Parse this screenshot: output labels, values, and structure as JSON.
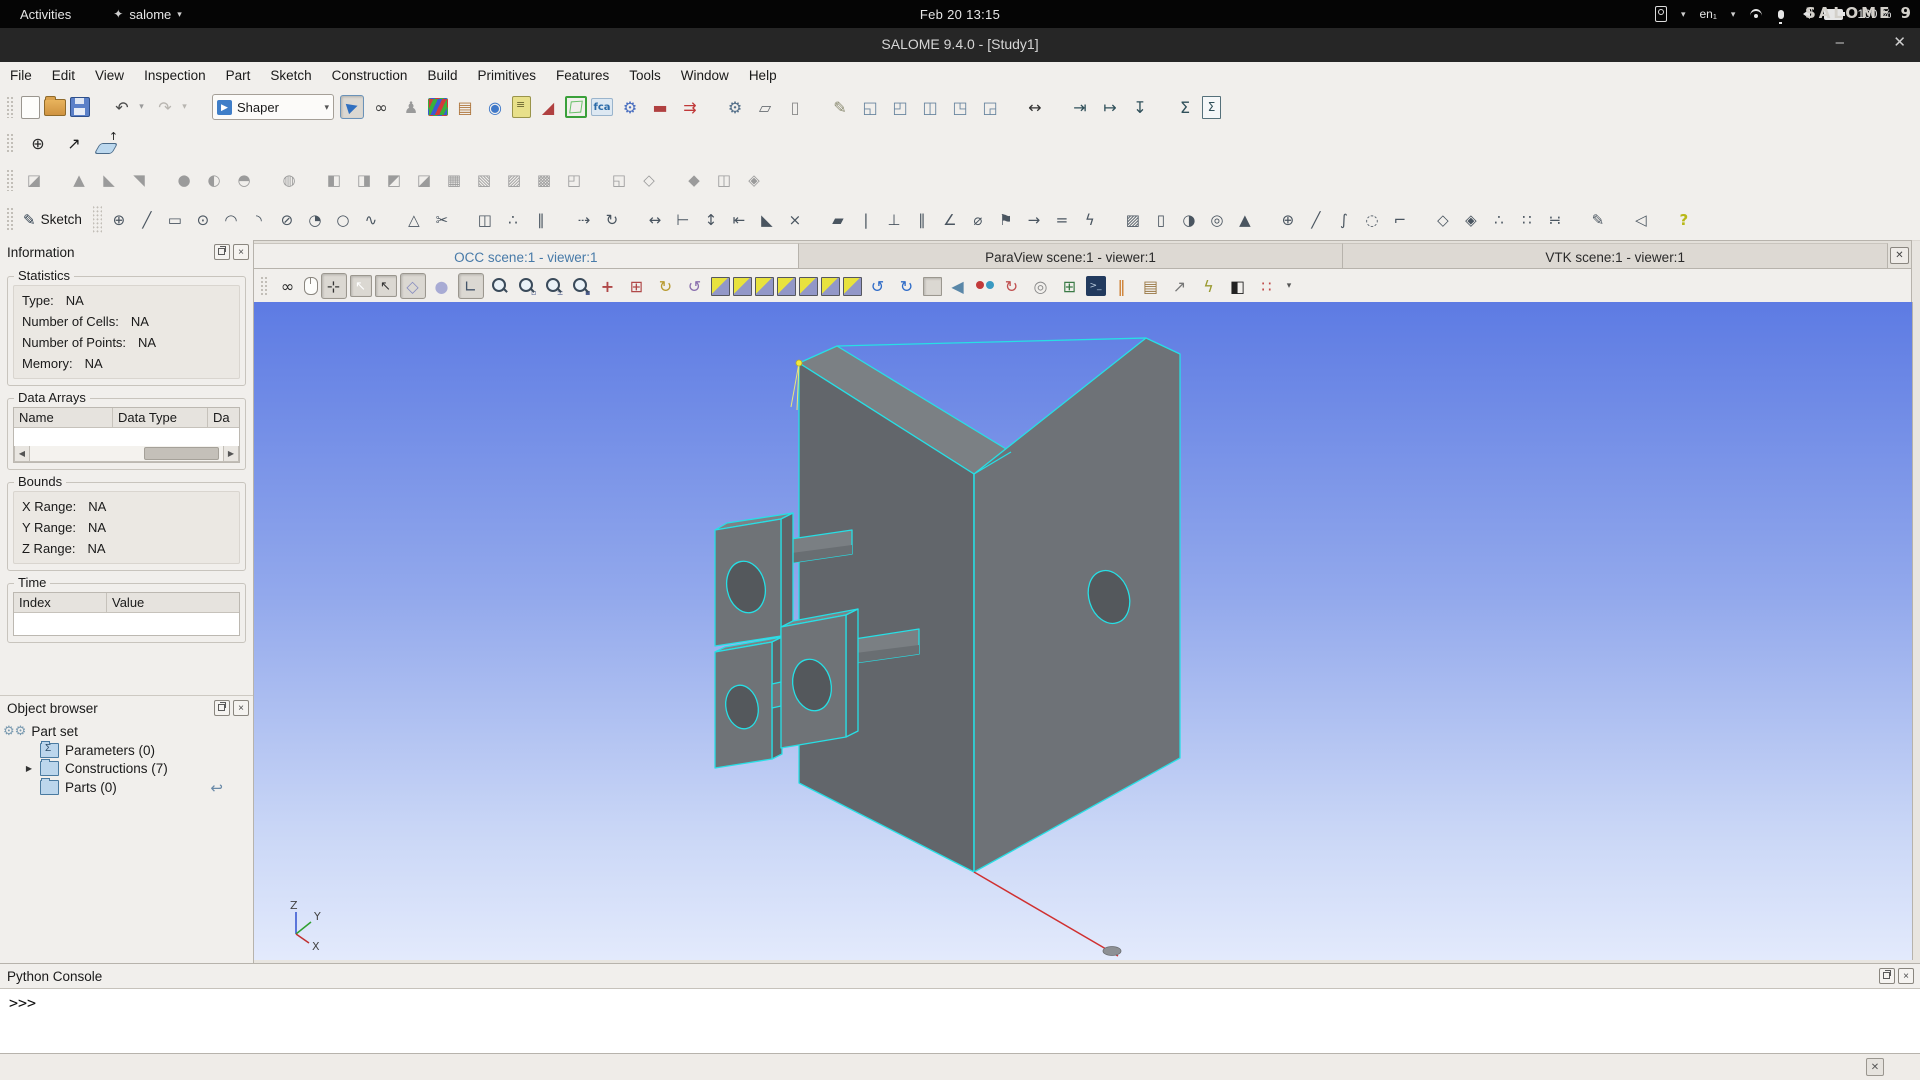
{
  "gnome_bar": {
    "activities": "Activities",
    "app_menu": "salome",
    "clock": "Feb 20 13:15",
    "keyboard_layout": "en₁",
    "battery_percent": "100 %"
  },
  "window": {
    "title": "SALOME 9.4.0 - [Study1]",
    "watermark": "SALOME 9"
  },
  "menu_bar": {
    "items": [
      "File",
      "Edit",
      "View",
      "Inspection",
      "Part",
      "Sketch",
      "Construction",
      "Build",
      "Primitives",
      "Features",
      "Tools",
      "Window",
      "Help"
    ]
  },
  "module_selector": {
    "value": "Shaper"
  },
  "toolbar_main": {
    "items": [
      {
        "name": "new-document",
        "kind": "page"
      },
      {
        "name": "open-document",
        "kind": "folder"
      },
      {
        "name": "save-document",
        "kind": "floppy"
      },
      {
        "sep": true
      },
      {
        "name": "undo",
        "glyph": "↶",
        "color": "#4a4a4a"
      },
      {
        "name": "undo-options",
        "glyph": "▾",
        "color": "#9a9a9a",
        "small": true
      },
      {
        "name": "redo",
        "glyph": "↷",
        "color": "#b8b5b0"
      },
      {
        "name": "redo-options",
        "glyph": "▾",
        "color": "#b8b5b0",
        "small": true
      },
      {
        "sep": true
      },
      {
        "combo": true,
        "name": "module-selector"
      },
      {
        "name": "shaper-module",
        "kind": "shaper",
        "pressed": true
      },
      {
        "name": "module-binoculars",
        "glyph": "∞",
        "color": "#3a3a3a"
      },
      {
        "name": "module-mesh",
        "glyph": "♟",
        "color": "#9a9a9a"
      },
      {
        "name": "module-paravis",
        "kind": "rgb"
      },
      {
        "name": "module-blocks",
        "glyph": "▤",
        "color": "#b07840"
      },
      {
        "name": "module-globe",
        "glyph": "◉",
        "color": "#3f78c8"
      },
      {
        "name": "module-notebook",
        "kind": "notepad"
      },
      {
        "name": "module-tool-red",
        "glyph": "◢",
        "color": "#b04040"
      },
      {
        "name": "module-geometry",
        "kind": "greenbox"
      },
      {
        "name": "module-fca",
        "kind": "fca"
      },
      {
        "name": "module-gear",
        "glyph": "⚙",
        "color": "#4a6fc0"
      },
      {
        "name": "module-hammer",
        "glyph": "▬",
        "color": "#b04040"
      },
      {
        "name": "module-arrows",
        "glyph": "⇉",
        "color": "#c03838"
      },
      {
        "sep": true
      },
      {
        "name": "settings",
        "glyph": "⚙",
        "color": "#55708a"
      },
      {
        "name": "copy",
        "glyph": "▱",
        "color": "#6a6f74"
      },
      {
        "name": "delete",
        "glyph": "▯",
        "color": "#8a8a8a"
      },
      {
        "sep": true
      },
      {
        "name": "dump-study",
        "glyph": "✎",
        "color": "#8a8a70"
      },
      {
        "name": "window-new",
        "glyph": "◱",
        "color": "#6a86a0"
      },
      {
        "name": "window-up",
        "glyph": "◰",
        "color": "#6a86a0"
      },
      {
        "name": "window-split",
        "glyph": "◫",
        "color": "#6a86a0"
      },
      {
        "name": "window-arrange",
        "glyph": "◳",
        "color": "#6a86a0"
      },
      {
        "name": "window-tools",
        "glyph": "◲",
        "color": "#6a86a0"
      },
      {
        "sep": true
      },
      {
        "name": "fit-width",
        "glyph": "↔",
        "color": "#333333"
      },
      {
        "sep": true
      },
      {
        "name": "import",
        "glyph": "⇥",
        "color": "#30505a"
      },
      {
        "name": "export",
        "glyph": "↦",
        "color": "#30505a"
      },
      {
        "name": "load-script",
        "glyph": "↧",
        "color": "#30505a"
      },
      {
        "sep": true
      },
      {
        "name": "notebook-sigma",
        "glyph": "Σ",
        "color": "#30505a"
      },
      {
        "name": "sigma-document",
        "kind": "sigma-doc"
      }
    ]
  },
  "toolbar_points": {
    "items": [
      {
        "name": "point",
        "glyph": "⊕",
        "color": "#2a2a2a"
      },
      {
        "name": "axis",
        "glyph": "↗",
        "color": "#1a1a1a"
      },
      {
        "name": "plane",
        "kind": "plane"
      }
    ]
  },
  "toolbar_features": {
    "items": [
      {
        "name": "load-result",
        "glyph": "◪",
        "color": "#9b9b9b"
      },
      {
        "sep": true
      },
      {
        "name": "extrusion",
        "glyph": "▲",
        "color": "#9b9b9b"
      },
      {
        "name": "extrusion-cut",
        "glyph": "◣",
        "color": "#9b9b9b"
      },
      {
        "name": "extrusion-fuse",
        "glyph": "◥",
        "color": "#9b9b9b"
      },
      {
        "sep": true
      },
      {
        "name": "revolution",
        "glyph": "●",
        "color": "#9b9b9b"
      },
      {
        "name": "revolution-cut",
        "glyph": "◐",
        "color": "#9b9b9b"
      },
      {
        "name": "revolution-fuse",
        "glyph": "◓",
        "color": "#9b9b9b"
      },
      {
        "sep": true
      },
      {
        "name": "pipe",
        "glyph": "◍",
        "color": "#9b9b9b"
      },
      {
        "sep": true
      },
      {
        "name": "boolean-fuse",
        "glyph": "◧",
        "color": "#9b9b9b"
      },
      {
        "name": "boolean-cut",
        "glyph": "◨",
        "color": "#9b9b9b"
      },
      {
        "name": "boolean-common",
        "glyph": "◩",
        "color": "#9b9b9b"
      },
      {
        "name": "boolean-smash",
        "glyph": "◪",
        "color": "#9b9b9b"
      },
      {
        "name": "boolean-fill",
        "glyph": "▦",
        "color": "#9b9b9b"
      },
      {
        "name": "partition",
        "glyph": "▧",
        "color": "#9b9b9b"
      },
      {
        "name": "intersection",
        "glyph": "▨",
        "color": "#9b9b9b"
      },
      {
        "name": "union",
        "glyph": "▩",
        "color": "#9b9b9b"
      },
      {
        "name": "remove-sub-shapes",
        "glyph": "◰",
        "color": "#9b9b9b"
      },
      {
        "sep": true
      },
      {
        "name": "placement",
        "glyph": "◱",
        "color": "#9b9b9b"
      },
      {
        "name": "translation",
        "glyph": "◇",
        "color": "#9b9b9b"
      },
      {
        "sep": true
      },
      {
        "name": "rotation",
        "glyph": "◆",
        "color": "#9b9b9b"
      },
      {
        "name": "symmetry",
        "glyph": "◫",
        "color": "#9b9b9b"
      },
      {
        "name": "scale",
        "glyph": "◈",
        "color": "#9b9b9b"
      }
    ]
  },
  "toolbar_sketch": {
    "button_label": "Sketch",
    "items": [
      {
        "name": "sketch-point",
        "glyph": "⊕"
      },
      {
        "name": "sketch-line",
        "glyph": "╱"
      },
      {
        "name": "sketch-rectangle",
        "glyph": "▭"
      },
      {
        "name": "sketch-circle",
        "glyph": "⊙"
      },
      {
        "name": "sketch-arc",
        "glyph": "◠"
      },
      {
        "name": "sketch-tangent-arc",
        "glyph": "◝"
      },
      {
        "name": "sketch-ellipse",
        "glyph": "⊘"
      },
      {
        "name": "sketch-elliptic-arc",
        "glyph": "◔"
      },
      {
        "name": "sketch-circle-3pt",
        "glyph": "○"
      },
      {
        "name": "sketch-bspline",
        "glyph": "∿"
      },
      {
        "sep": true
      },
      {
        "name": "sketch-projection",
        "glyph": "△"
      },
      {
        "name": "sketch-trim",
        "glyph": "✂"
      },
      {
        "sep": true
      },
      {
        "name": "sketch-mirror",
        "glyph": "◫"
      },
      {
        "name": "sketch-angular-copy",
        "glyph": "∴"
      },
      {
        "name": "sketch-linear-copy",
        "glyph": "∥"
      },
      {
        "sep": true
      },
      {
        "name": "sketch-translation",
        "glyph": "⇢"
      },
      {
        "name": "sketch-rotation",
        "glyph": "↻"
      },
      {
        "sep": true
      },
      {
        "name": "constraint-distance",
        "glyph": "↔"
      },
      {
        "name": "constraint-length",
        "glyph": "⊢"
      },
      {
        "name": "constraint-vertical-distance",
        "glyph": "↕"
      },
      {
        "name": "constraint-horizontal-distance",
        "glyph": "⇤"
      },
      {
        "name": "constraint-angle-ruler",
        "glyph": "◣"
      },
      {
        "name": "sketch-split",
        "glyph": "×"
      },
      {
        "sep": true
      },
      {
        "name": "constraint-hatch",
        "glyph": "▰"
      },
      {
        "name": "constraint-vertical",
        "glyph": "|"
      },
      {
        "name": "constraint-horizontal",
        "glyph": "⊥"
      },
      {
        "name": "constraint-parallel",
        "glyph": "∥"
      },
      {
        "name": "constraint-angle",
        "glyph": "∠"
      },
      {
        "name": "constraint-radius",
        "glyph": "⌀"
      },
      {
        "name": "constraint-fixed",
        "glyph": "⚑"
      },
      {
        "name": "constraint-midpoint",
        "glyph": "→"
      },
      {
        "name": "constraint-equal",
        "glyph": "="
      },
      {
        "name": "constraint-auto",
        "glyph": "ϟ"
      },
      {
        "sep": true
      },
      {
        "name": "primitive-box",
        "glyph": "▨"
      },
      {
        "name": "primitive-cylinder",
        "glyph": "▯"
      },
      {
        "name": "primitive-sphere",
        "glyph": "◑"
      },
      {
        "name": "primitive-torus",
        "glyph": "◎"
      },
      {
        "name": "primitive-cone",
        "glyph": "▲"
      },
      {
        "sep": true
      },
      {
        "name": "point-3d",
        "glyph": "⊕"
      },
      {
        "name": "line-3d",
        "glyph": "╱"
      },
      {
        "name": "curve-3d",
        "glyph": "∫"
      },
      {
        "name": "circle-3d",
        "glyph": "◌"
      },
      {
        "name": "polyline",
        "glyph": "⌐"
      },
      {
        "sep": true
      },
      {
        "name": "polygon-points",
        "glyph": "◇"
      },
      {
        "name": "solid-points",
        "glyph": "◈"
      },
      {
        "name": "cloud-small",
        "glyph": "∴"
      },
      {
        "name": "cloud-medium",
        "glyph": "∷"
      },
      {
        "name": "cloud-large",
        "glyph": "∺"
      },
      {
        "sep": true
      },
      {
        "name": "edit-features",
        "glyph": "✎"
      },
      {
        "sep": true
      },
      {
        "name": "shape-group",
        "glyph": "◁"
      },
      {
        "sep": true
      },
      {
        "name": "help",
        "glyph": "?",
        "color": "#b8b818",
        "bold": true
      }
    ]
  },
  "tabs": {
    "items": [
      {
        "name": "tab-occ",
        "label": "OCC scene:1 - viewer:1",
        "active": true
      },
      {
        "name": "tab-paraview",
        "label": "ParaView scene:1 - viewer:1",
        "active": false
      },
      {
        "name": "tab-vtk",
        "label": "VTK scene:1 - viewer:1",
        "active": false
      }
    ]
  },
  "viewer_toolbar": {
    "items": [
      {
        "name": "dump-view",
        "glyph": "∞",
        "color": "#2a2a2a"
      },
      {
        "name": "mouse-bindings",
        "kind": "mouse"
      },
      {
        "name": "zoom-cursor",
        "glyph": "⊹",
        "color": "#333333",
        "pressed": true
      },
      {
        "name": "select-cursor",
        "kind": "cursor-blue",
        "pressed": true
      },
      {
        "name": "highlight-cursor",
        "kind": "cursor-yellow",
        "pressed": true
      },
      {
        "name": "polygon-selection",
        "glyph": "◇",
        "color": "#8a8fc0",
        "pressed": true,
        "bold": true
      },
      {
        "name": "circle-selection",
        "glyph": "●",
        "color": "#a8abd4"
      },
      {
        "name": "local-trihedron",
        "glyph": "∟",
        "color": "#44556a",
        "pressed": true
      },
      {
        "name": "fit-all",
        "kind": "mag"
      },
      {
        "name": "fit-area",
        "kind": "mag",
        "sub": "▫"
      },
      {
        "name": "zoom",
        "kind": "mag",
        "sub": "±"
      },
      {
        "name": "zoom-selection",
        "kind": "mag",
        "sub": "▪"
      },
      {
        "name": "pan",
        "glyph": "+",
        "color": "#b04848",
        "bold": true
      },
      {
        "name": "global-pan",
        "glyph": "⊞",
        "color": "#b04848"
      },
      {
        "name": "rotation-point",
        "glyph": "↻",
        "color": "#b89a30"
      },
      {
        "name": "rotation",
        "glyph": "↺",
        "color": "#8a6fae"
      },
      {
        "name": "view-front",
        "kind": "cube"
      },
      {
        "name": "view-back",
        "kind": "cube"
      },
      {
        "name": "view-top",
        "kind": "cube"
      },
      {
        "name": "view-bottom",
        "kind": "cube"
      },
      {
        "name": "view-left",
        "kind": "cube"
      },
      {
        "name": "view-right",
        "kind": "cube"
      },
      {
        "name": "view-isometric",
        "kind": "cube"
      },
      {
        "name": "rotate-counterclockwise",
        "glyph": "↺",
        "color": "#2f6cc8"
      },
      {
        "name": "rotate-clockwise",
        "glyph": "↻",
        "color": "#2f6cc8"
      },
      {
        "name": "reset-view",
        "kind": "cube",
        "pressed": true
      },
      {
        "name": "axonometric-view",
        "glyph": "◀",
        "color": "#5a87a8"
      },
      {
        "name": "stereo-view",
        "kind": "glasses"
      },
      {
        "name": "rotation-gizmo",
        "glyph": "↻",
        "color": "#c05050"
      },
      {
        "name": "ambient-light",
        "glyph": "◎",
        "color": "#888888"
      },
      {
        "name": "export-scene",
        "glyph": "⊞",
        "color": "#3a7a46"
      },
      {
        "name": "scene-settings",
        "kind": "dark-square"
      },
      {
        "name": "sync-views",
        "glyph": "‖",
        "color": "#cc7a2a"
      },
      {
        "name": "measurements",
        "glyph": "▤",
        "color": "#997744"
      },
      {
        "name": "measure-distance",
        "glyph": "↗",
        "color": "#777777"
      },
      {
        "name": "light-source",
        "glyph": "ϟ",
        "color": "#9a9a30"
      },
      {
        "name": "background-color",
        "glyph": "◧",
        "color": "#222222"
      },
      {
        "name": "presentation-params",
        "glyph": "∷",
        "color": "#c04848"
      },
      {
        "name": "presentation-options",
        "glyph": "▾",
        "color": "#555555",
        "small": true
      }
    ]
  },
  "info_panel": {
    "title": "Information",
    "statistics": {
      "title": "Statistics",
      "rows": [
        {
          "label": "Type:",
          "value": "NA"
        },
        {
          "label": "Number of Cells:",
          "value": "NA"
        },
        {
          "label": "Number of Points:",
          "value": "NA"
        },
        {
          "label": "Memory:",
          "value": "NA"
        }
      ]
    },
    "data_arrays": {
      "title": "Data Arrays",
      "columns": [
        "Name",
        "Data Type",
        "Da"
      ]
    },
    "bounds": {
      "title": "Bounds",
      "rows": [
        {
          "label": "X Range:",
          "value": "NA"
        },
        {
          "label": "Y Range:",
          "value": "NA"
        },
        {
          "label": "Z Range:",
          "value": "NA"
        }
      ]
    },
    "time": {
      "title": "Time",
      "columns": [
        "Index",
        "Value"
      ]
    }
  },
  "object_browser": {
    "title": "Object browser",
    "root_label": "Part set",
    "items": [
      {
        "name": "parameters",
        "icon": "sigma-folder",
        "label": "Parameters (0)",
        "expandable": false
      },
      {
        "name": "constructions",
        "icon": "folder",
        "label": "Constructions (7)",
        "expandable": true
      },
      {
        "name": "parts",
        "icon": "folder",
        "label": "Parts (0)",
        "expandable": false,
        "trailing": "reload"
      }
    ]
  },
  "viewport": {
    "axes": {
      "x": "X",
      "y": "Y",
      "z": "Z"
    },
    "colors": {
      "bg_top": "#5d7be3",
      "bg_bottom": "#e3eafc",
      "face_left": "#62666b",
      "face_right": "#6e7277",
      "face_top": "#7b8084",
      "edge_highlight": "#27dfe5",
      "axis_line_red": "#d03030",
      "vertex_marker": "#f2e93e"
    }
  },
  "python_console": {
    "title": "Python Console",
    "prompt": ">>>"
  }
}
